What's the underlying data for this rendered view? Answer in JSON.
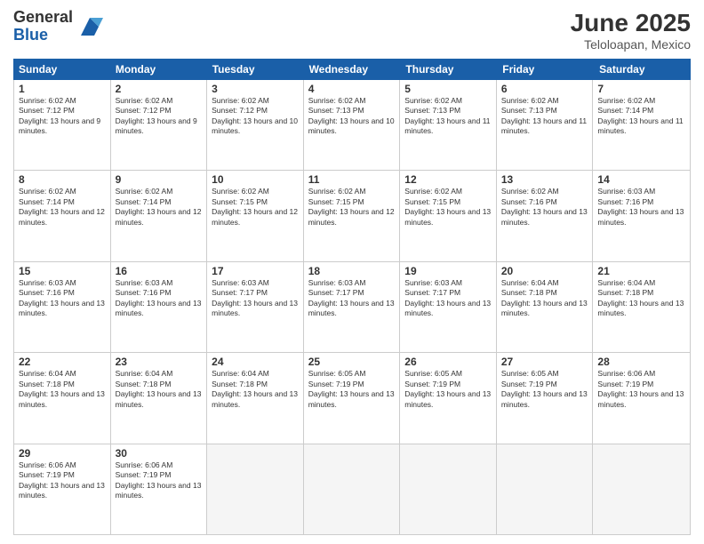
{
  "logo": {
    "general": "General",
    "blue": "Blue"
  },
  "title": "June 2025",
  "location": "Teloloapan, Mexico",
  "weekdays": [
    "Sunday",
    "Monday",
    "Tuesday",
    "Wednesday",
    "Thursday",
    "Friday",
    "Saturday"
  ],
  "rows": [
    [
      {
        "day": "1",
        "sunrise": "6:02 AM",
        "sunset": "7:12 PM",
        "daylight": "13 hours and 9 minutes."
      },
      {
        "day": "2",
        "sunrise": "6:02 AM",
        "sunset": "7:12 PM",
        "daylight": "13 hours and 9 minutes."
      },
      {
        "day": "3",
        "sunrise": "6:02 AM",
        "sunset": "7:12 PM",
        "daylight": "13 hours and 10 minutes."
      },
      {
        "day": "4",
        "sunrise": "6:02 AM",
        "sunset": "7:13 PM",
        "daylight": "13 hours and 10 minutes."
      },
      {
        "day": "5",
        "sunrise": "6:02 AM",
        "sunset": "7:13 PM",
        "daylight": "13 hours and 11 minutes."
      },
      {
        "day": "6",
        "sunrise": "6:02 AM",
        "sunset": "7:13 PM",
        "daylight": "13 hours and 11 minutes."
      },
      {
        "day": "7",
        "sunrise": "6:02 AM",
        "sunset": "7:14 PM",
        "daylight": "13 hours and 11 minutes."
      }
    ],
    [
      {
        "day": "8",
        "sunrise": "6:02 AM",
        "sunset": "7:14 PM",
        "daylight": "13 hours and 12 minutes."
      },
      {
        "day": "9",
        "sunrise": "6:02 AM",
        "sunset": "7:14 PM",
        "daylight": "13 hours and 12 minutes."
      },
      {
        "day": "10",
        "sunrise": "6:02 AM",
        "sunset": "7:15 PM",
        "daylight": "13 hours and 12 minutes."
      },
      {
        "day": "11",
        "sunrise": "6:02 AM",
        "sunset": "7:15 PM",
        "daylight": "13 hours and 12 minutes."
      },
      {
        "day": "12",
        "sunrise": "6:02 AM",
        "sunset": "7:15 PM",
        "daylight": "13 hours and 13 minutes."
      },
      {
        "day": "13",
        "sunrise": "6:02 AM",
        "sunset": "7:16 PM",
        "daylight": "13 hours and 13 minutes."
      },
      {
        "day": "14",
        "sunrise": "6:03 AM",
        "sunset": "7:16 PM",
        "daylight": "13 hours and 13 minutes."
      }
    ],
    [
      {
        "day": "15",
        "sunrise": "6:03 AM",
        "sunset": "7:16 PM",
        "daylight": "13 hours and 13 minutes."
      },
      {
        "day": "16",
        "sunrise": "6:03 AM",
        "sunset": "7:16 PM",
        "daylight": "13 hours and 13 minutes."
      },
      {
        "day": "17",
        "sunrise": "6:03 AM",
        "sunset": "7:17 PM",
        "daylight": "13 hours and 13 minutes."
      },
      {
        "day": "18",
        "sunrise": "6:03 AM",
        "sunset": "7:17 PM",
        "daylight": "13 hours and 13 minutes."
      },
      {
        "day": "19",
        "sunrise": "6:03 AM",
        "sunset": "7:17 PM",
        "daylight": "13 hours and 13 minutes."
      },
      {
        "day": "20",
        "sunrise": "6:04 AM",
        "sunset": "7:18 PM",
        "daylight": "13 hours and 13 minutes."
      },
      {
        "day": "21",
        "sunrise": "6:04 AM",
        "sunset": "7:18 PM",
        "daylight": "13 hours and 13 minutes."
      }
    ],
    [
      {
        "day": "22",
        "sunrise": "6:04 AM",
        "sunset": "7:18 PM",
        "daylight": "13 hours and 13 minutes."
      },
      {
        "day": "23",
        "sunrise": "6:04 AM",
        "sunset": "7:18 PM",
        "daylight": "13 hours and 13 minutes."
      },
      {
        "day": "24",
        "sunrise": "6:04 AM",
        "sunset": "7:18 PM",
        "daylight": "13 hours and 13 minutes."
      },
      {
        "day": "25",
        "sunrise": "6:05 AM",
        "sunset": "7:19 PM",
        "daylight": "13 hours and 13 minutes."
      },
      {
        "day": "26",
        "sunrise": "6:05 AM",
        "sunset": "7:19 PM",
        "daylight": "13 hours and 13 minutes."
      },
      {
        "day": "27",
        "sunrise": "6:05 AM",
        "sunset": "7:19 PM",
        "daylight": "13 hours and 13 minutes."
      },
      {
        "day": "28",
        "sunrise": "6:06 AM",
        "sunset": "7:19 PM",
        "daylight": "13 hours and 13 minutes."
      }
    ],
    [
      {
        "day": "29",
        "sunrise": "6:06 AM",
        "sunset": "7:19 PM",
        "daylight": "13 hours and 13 minutes."
      },
      {
        "day": "30",
        "sunrise": "6:06 AM",
        "sunset": "7:19 PM",
        "daylight": "13 hours and 13 minutes."
      },
      null,
      null,
      null,
      null,
      null
    ]
  ]
}
